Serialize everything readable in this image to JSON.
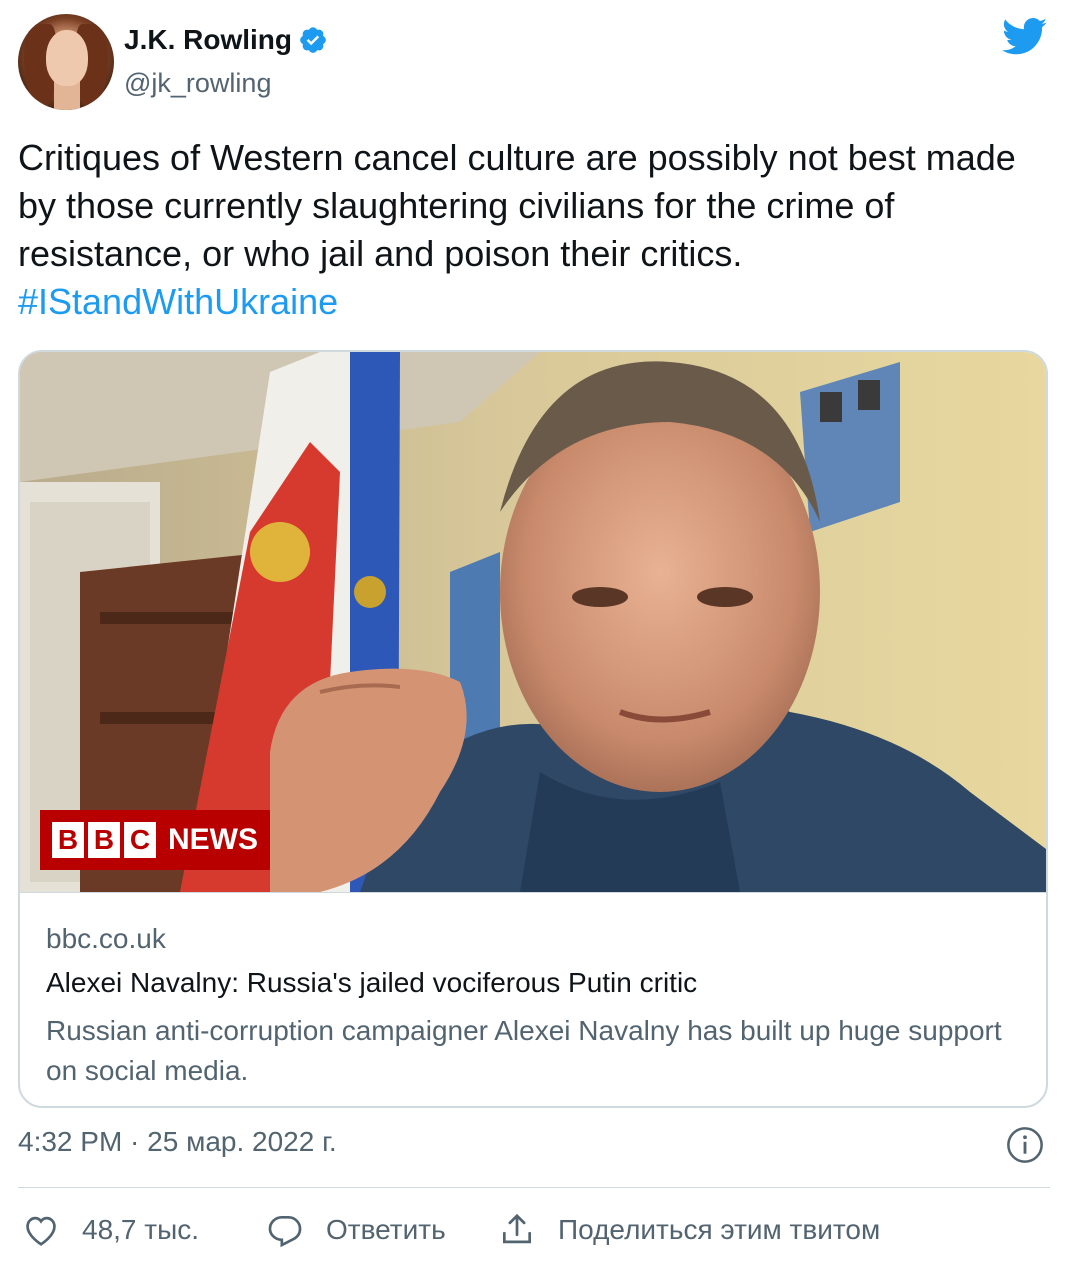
{
  "author": {
    "name": "J.K. Rowling",
    "handle": "@jk_rowling",
    "verified_color": "#1d9bf0"
  },
  "tweet": {
    "text": "Critiques of Western cancel culture are possibly not best made by those currently slaughtering civilians for the crime of resistance, or who jail and poison their critics.",
    "hashtag": "#IStandWithUkraine",
    "hashtag_color": "#1d9bf0"
  },
  "card": {
    "logo_letters": [
      "B",
      "B",
      "C"
    ],
    "logo_news": "NEWS",
    "domain": "bbc.co.uk",
    "title": "Alexei Navalny: Russia's jailed vociferous Putin critic",
    "description": "Russian anti-corruption campaigner Alexei Navalny has built up huge support on social media."
  },
  "timestamp": "4:32 PM · 25 мар. 2022 г.",
  "actions": {
    "like_count": "48,7 тыс.",
    "reply_label": "Ответить",
    "share_label": "Поделиться этим твитом"
  },
  "icons": {
    "bird": "twitter-bird-icon",
    "verified": "verified-badge-icon",
    "info": "info-icon",
    "like": "heart-icon",
    "reply": "reply-bubble-icon",
    "share": "share-icon"
  }
}
